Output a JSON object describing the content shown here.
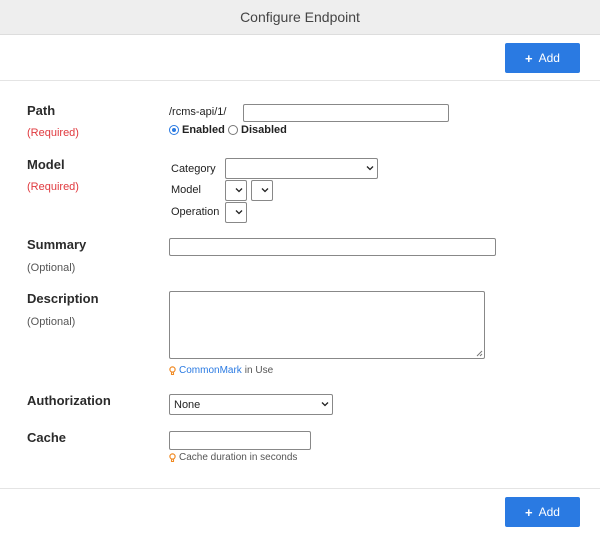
{
  "window": {
    "title": "Configure Endpoint"
  },
  "toolbar": {
    "add_label": "Add"
  },
  "path": {
    "label": "Path",
    "required": "(Required)",
    "prefix": "/rcms-api/1/",
    "value": "",
    "enabled_label": "Enabled",
    "disabled_label": "Disabled",
    "selected": "Enabled"
  },
  "model": {
    "label": "Model",
    "required": "(Required)",
    "category_label": "Category",
    "category_value": "",
    "model_label": "Model",
    "model_value_1": "",
    "model_value_2": "",
    "operation_label": "Operation",
    "operation_value": ""
  },
  "summary": {
    "label": "Summary",
    "optional": "(Optional)",
    "value": ""
  },
  "description": {
    "label": "Description",
    "optional": "(Optional)",
    "value": "",
    "hint_link": "CommonMark",
    "hint_text": "in Use"
  },
  "authorization": {
    "label": "Authorization",
    "value": "None"
  },
  "cache": {
    "label": "Cache",
    "value": "",
    "hint": "Cache duration in seconds"
  },
  "colors": {
    "accent": "#2a7ae2",
    "required": "#e0393e",
    "hint_icon": "#f08a24"
  }
}
